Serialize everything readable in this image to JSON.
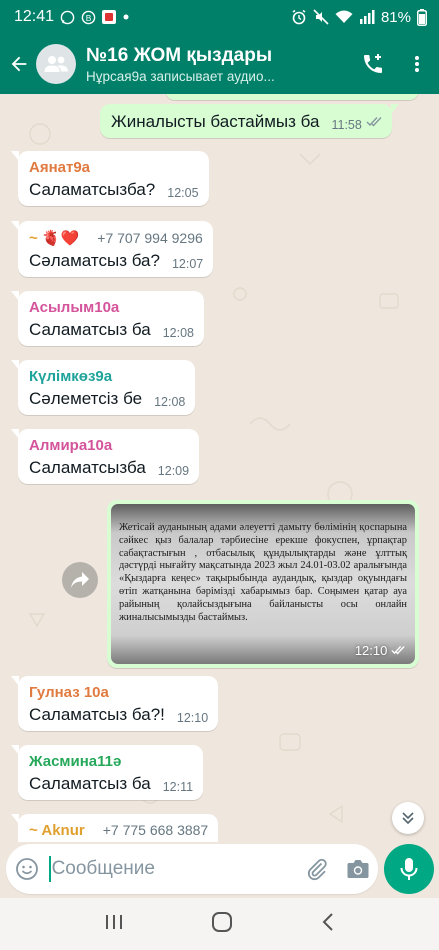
{
  "status_bar": {
    "time": "12:41",
    "battery": "81%"
  },
  "header": {
    "title": "№16 ЖОМ қыздары",
    "subtitle": "Нұрсая9а записывает аудио..."
  },
  "messages": [
    {
      "id": "m0",
      "dir": "out",
      "text": "Жиналысты бастаймыз ба",
      "time": "11:58",
      "read": true
    },
    {
      "id": "m1",
      "dir": "in",
      "sender": "Аянат9а",
      "sender_color": "#e07a3f",
      "text": "Саламатсызба?",
      "time": "12:05"
    },
    {
      "id": "m2",
      "dir": "in",
      "sender": "~ 🫀❤️",
      "sender_color": "#e0a030",
      "phone": "+7 707 994 9296",
      "text": "Сәламатсыз ба?",
      "time": "12:07"
    },
    {
      "id": "m3",
      "dir": "in",
      "sender": "Асылым10а",
      "sender_color": "#d4549b",
      "text": "Саламатсыз ба",
      "time": "12:08"
    },
    {
      "id": "m4",
      "dir": "in",
      "sender": "Күлімкөз9а",
      "sender_color": "#1fa39a",
      "text": "Сәлеметсіз бе",
      "time": "12:08"
    },
    {
      "id": "m5",
      "dir": "in",
      "sender": "Алмира10а",
      "sender_color": "#d4549b",
      "text": "Саламатсызба",
      "time": "12:09"
    },
    {
      "id": "m7",
      "dir": "in",
      "sender": "Гулназ 10а",
      "sender_color": "#e07a3f",
      "text": "Саламатсыз ба?!",
      "time": "12:10"
    },
    {
      "id": "m8",
      "dir": "in",
      "sender": "Жасмина11ә",
      "sender_color": "#26a85a",
      "text": "Саламатсыз  ба",
      "time": "12:11"
    },
    {
      "id": "m9",
      "dir": "in",
      "sender": "~ Aknur",
      "sender_color": "#e0a030",
      "phone": "+7 775 668 3887",
      "text": "",
      "time": ""
    }
  ],
  "image_message": {
    "time": "12:10",
    "read": true,
    "doc_text": "Жетісай ауданының адами әлеуетті дамыту бөлімінің қоспарына сәйкес қыз балалар тәрбиесіне ерекше фокуспен, ұрпақтар сабақтастығын , отбасылық құндылықтарды және ұлттық дәстүрді нығайту мақсатында 2023 жыл 24.01-03.02 аралығында «Қыздарға кеңес» тақырыбында аудандық, қыздар оқуындағы өтіп жатқанына бәрімізді хабарымыз бар. Соңымен қатар ауа райының қолайсыздығына байланысты осы онлайн жиналысымызды бастаймыз."
  },
  "compose": {
    "placeholder": "Сообщение"
  },
  "icons": {
    "back": "arrow-left-icon",
    "group_avatar": "group-icon",
    "call": "add-call-icon",
    "menu": "more-vert-icon",
    "emoji": "emoji-icon",
    "attach": "paperclip-icon",
    "camera": "camera-icon",
    "mic": "mic-icon",
    "forward": "forward-icon",
    "scroll_down": "double-chevron-down-icon"
  },
  "colors": {
    "header": "#008069",
    "accent": "#00a884",
    "outgoing_bubble": "#d9fdd3",
    "incoming_bubble": "#ffffff",
    "chat_bg": "#efe7dd",
    "read_tick": "#53bdeb"
  }
}
